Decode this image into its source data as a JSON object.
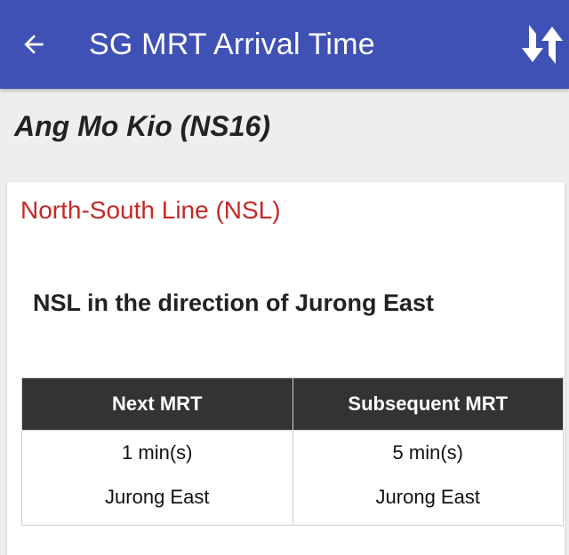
{
  "appbar": {
    "title": "SG MRT Arrival Time",
    "back_icon": "arrow-back-icon",
    "refresh_icon": "swap-refresh-icon",
    "color": "#3f51b5"
  },
  "station": {
    "title": "Ang Mo Kio (NS16)"
  },
  "line_card": {
    "line_name": "North-South Line (NSL)",
    "line_color": "#c62828",
    "direction": "NSL in the direction of Jurong East",
    "table": {
      "headers": [
        "Next MRT",
        "Subsequent MRT"
      ],
      "cells": [
        {
          "time": "1 min(s)",
          "destination": "Jurong East"
        },
        {
          "time": "5 min(s)",
          "destination": "Jurong East"
        }
      ]
    }
  }
}
